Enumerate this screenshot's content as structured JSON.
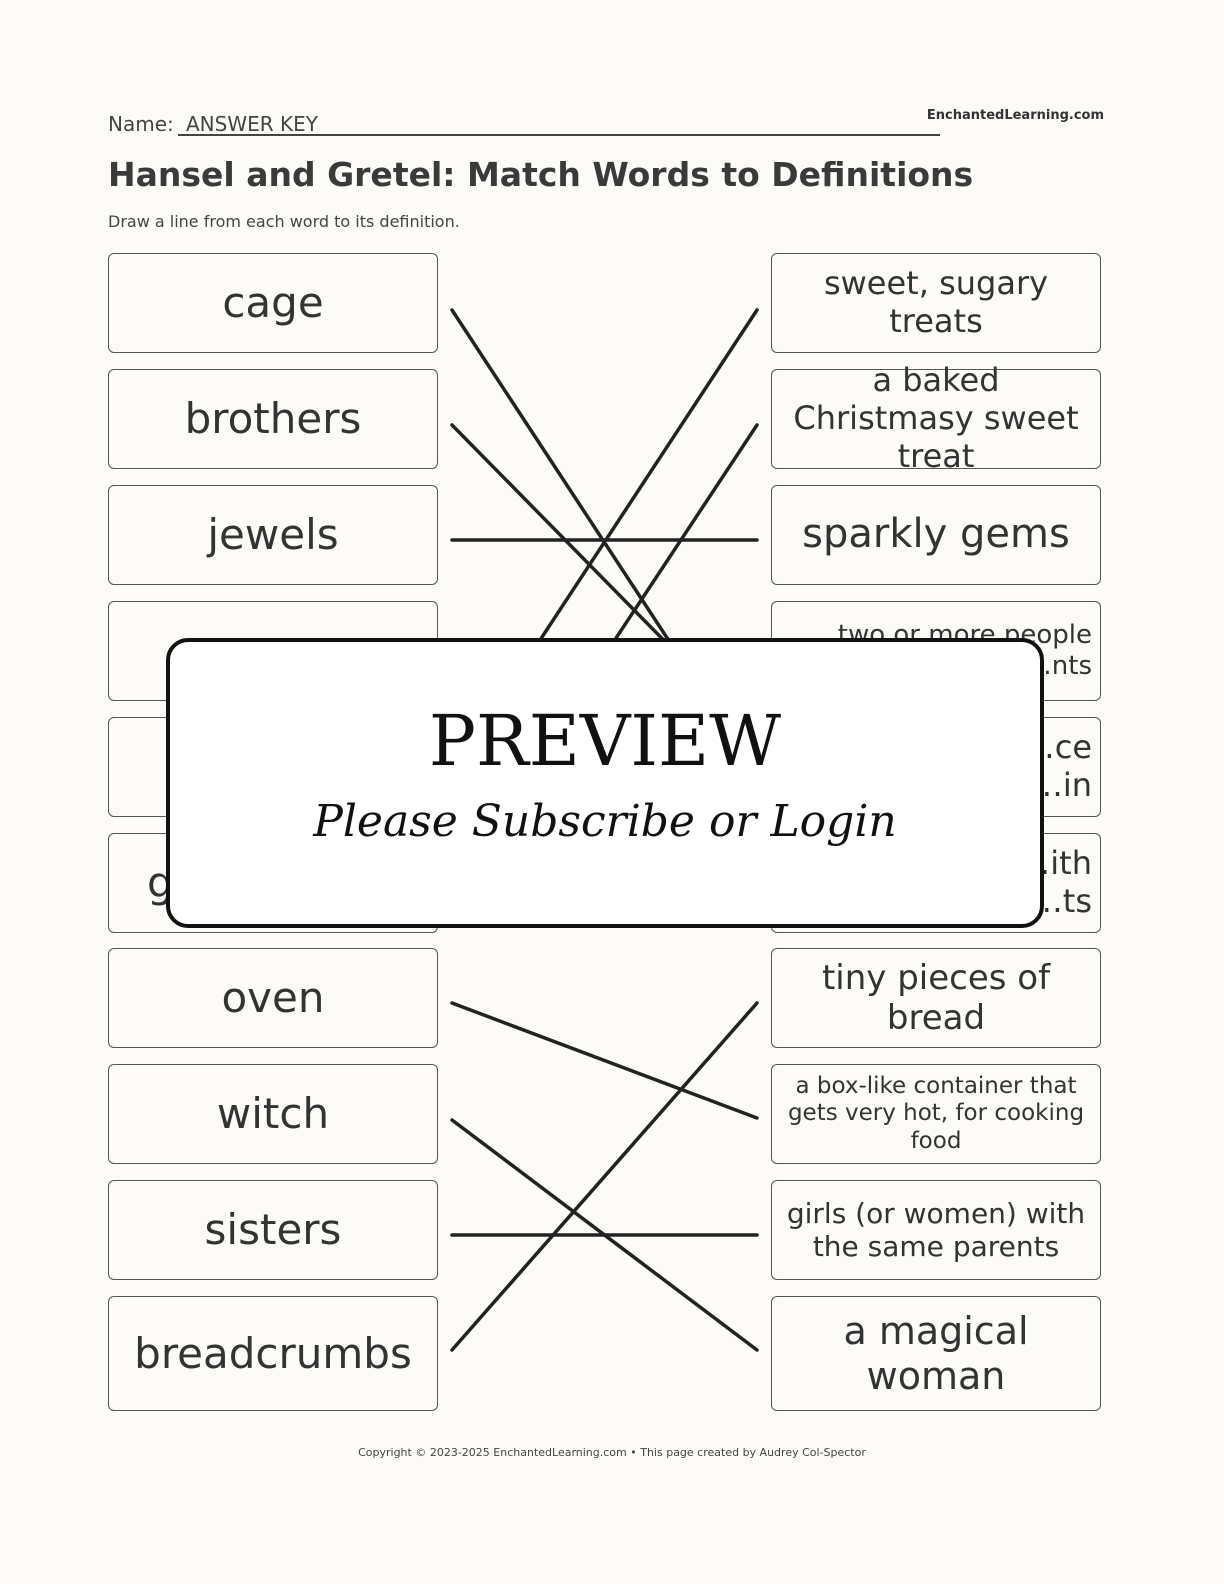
{
  "header": {
    "name_label": "Name:",
    "name_value": "ANSWER KEY",
    "brand": "EnchantedLearning.com"
  },
  "title": "Hansel and Gretel: Match Words to Definitions",
  "instructions": "Draw a line from each word to its definition.",
  "words": [
    "cage",
    "brothers",
    "jewels",
    "",
    "",
    "g",
    "oven",
    "witch",
    "sisters",
    "breadcrumbs"
  ],
  "definitions": [
    "sweet, sugary treats",
    "a baked Christmasy sweet treat",
    "sparkly gems",
    "two or more people\n…nts",
    "…ce\n…in",
    "…ith\n…ts",
    "tiny pieces of bread",
    "a box-like container that gets very hot, for cooking food",
    "girls (or women) with the same parents",
    "a magical woman"
  ],
  "overlay": {
    "heading": "PREVIEW",
    "subtext": "Please Subscribe or Login"
  },
  "footer": "Copyright © 2023-2025 EnchantedLearning.com • This page created by Audrey Col-Spector"
}
